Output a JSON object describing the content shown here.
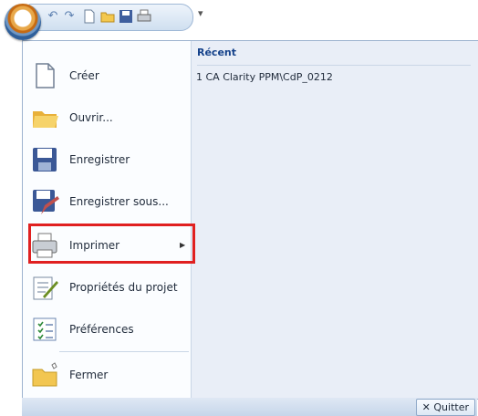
{
  "menu": {
    "items": [
      {
        "label": "Créer",
        "icon": "new-document-icon"
      },
      {
        "label": "Ouvrir...",
        "icon": "open-folder-icon"
      },
      {
        "label": "Enregistrer",
        "icon": "save-disk-icon"
      },
      {
        "label": "Enregistrer sous...",
        "icon": "save-as-icon"
      },
      {
        "label": "Imprimer",
        "icon": "printer-icon",
        "has_submenu": true
      },
      {
        "label": "Propriétés du projet",
        "icon": "properties-icon"
      },
      {
        "label": "Préférences",
        "icon": "preferences-icon"
      },
      {
        "label": "Fermer",
        "icon": "close-folder-icon"
      }
    ]
  },
  "recent": {
    "title": "Récent",
    "items": [
      "1 CA Clarity PPM\\CdP_0212"
    ]
  },
  "footer": {
    "quit_label": "Quitter"
  },
  "colors": {
    "highlight": "#e02020",
    "title": "#15428b"
  }
}
